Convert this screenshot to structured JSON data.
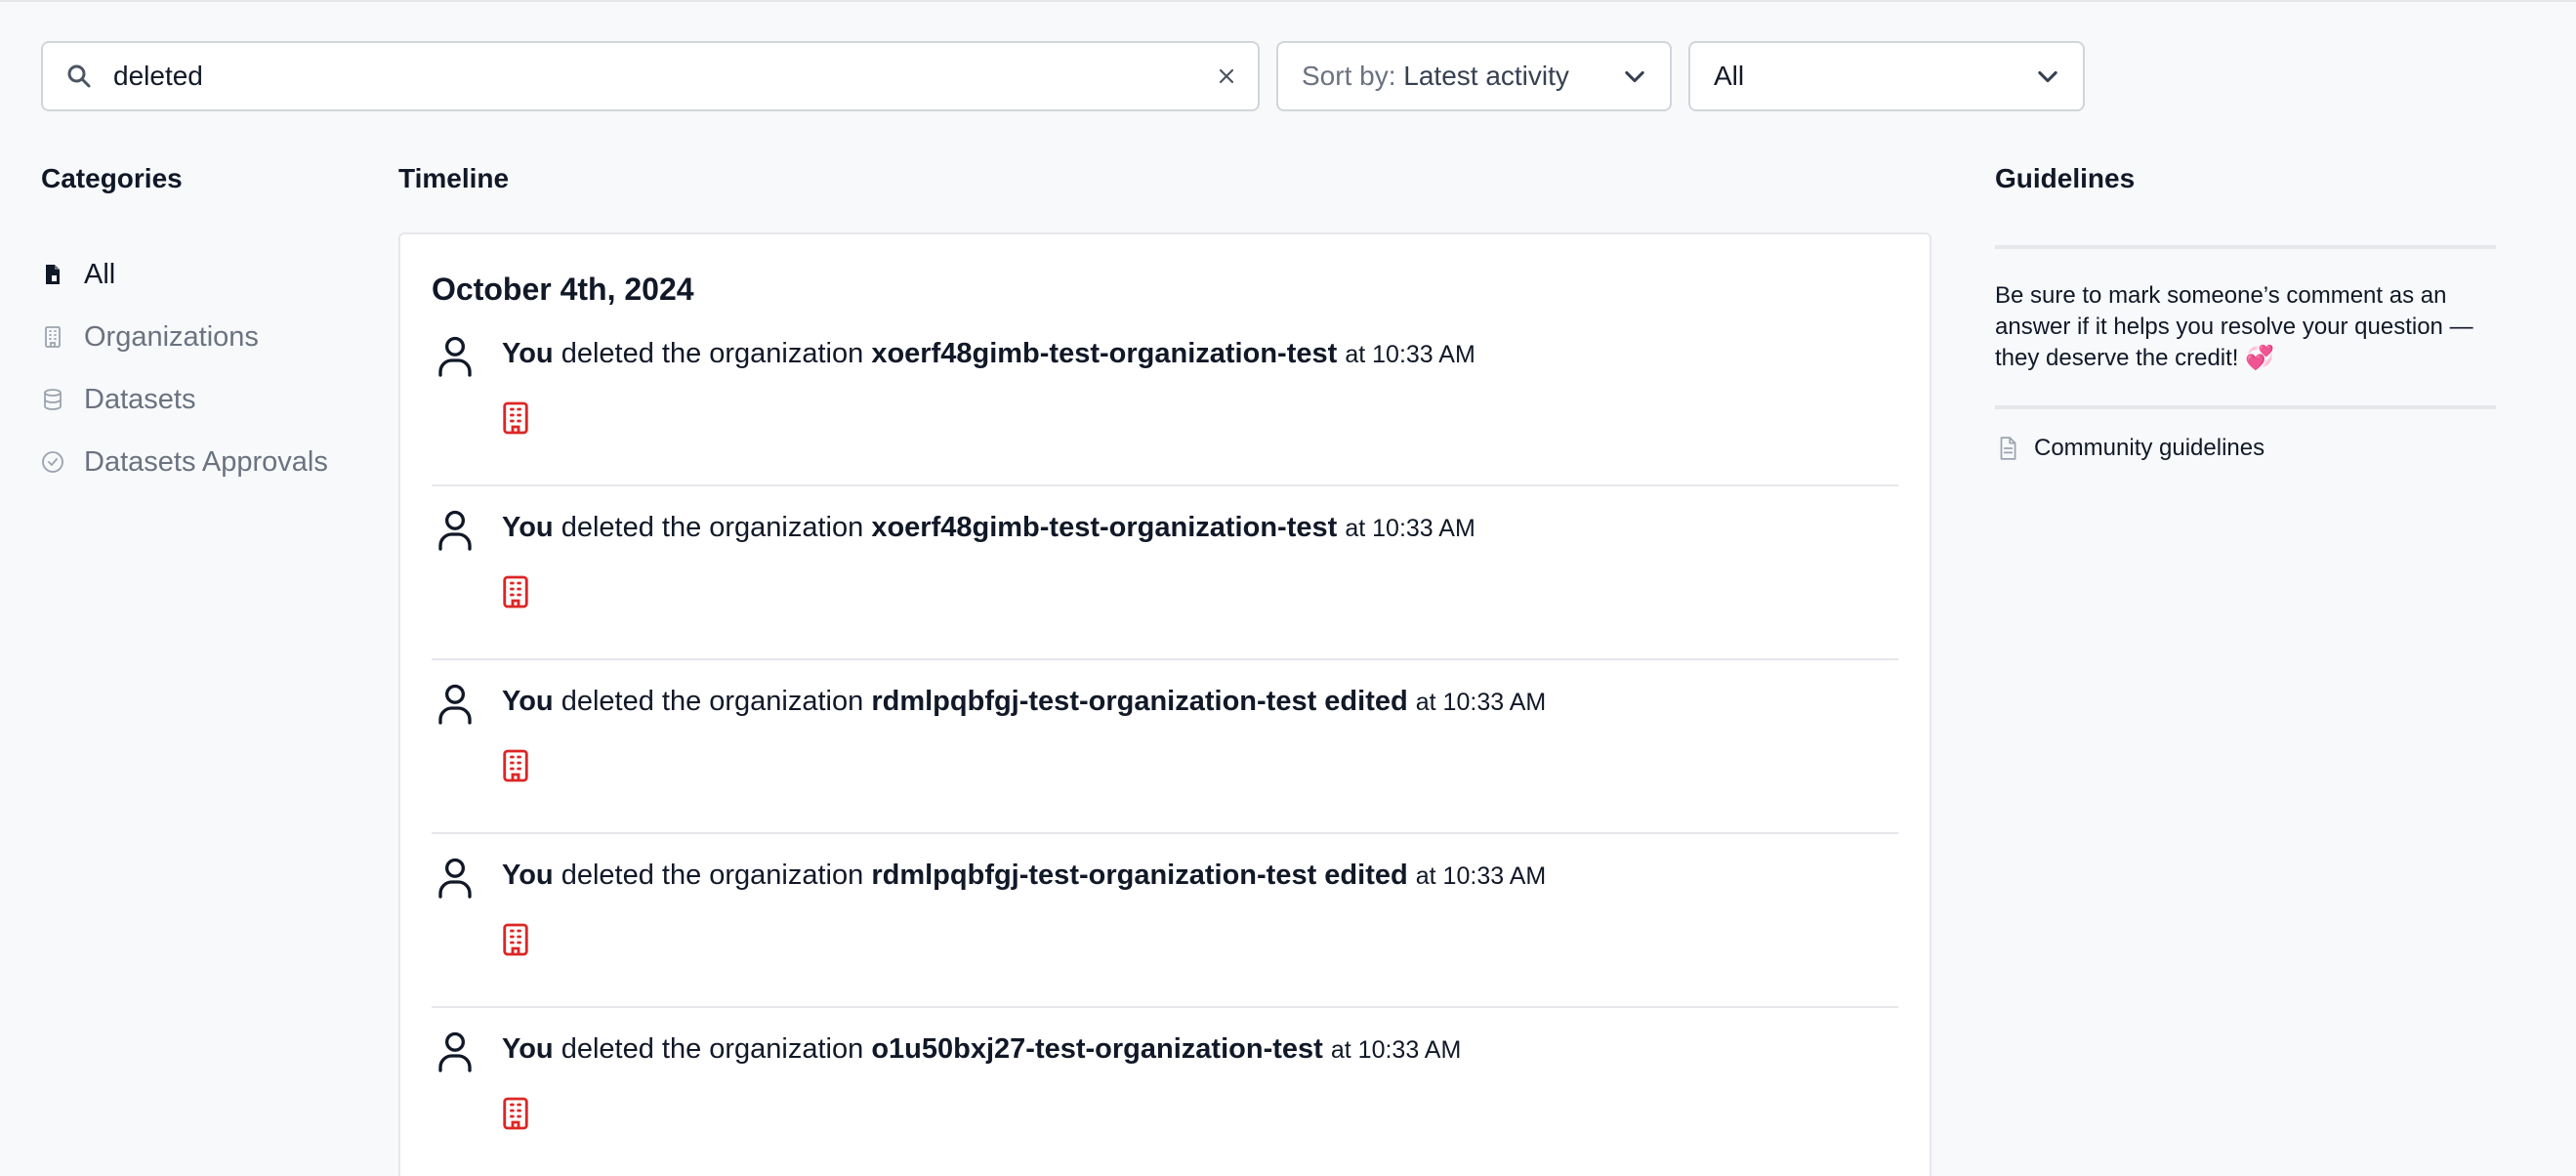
{
  "search": {
    "value": "deleted",
    "placeholder": "Search"
  },
  "sort": {
    "prefix": "Sort by:",
    "value": "Latest activity"
  },
  "filter": {
    "value": "All"
  },
  "categories": {
    "heading": "Categories",
    "items": [
      {
        "label": "All",
        "icon": "document-icon"
      },
      {
        "label": "Organizations",
        "icon": "building-icon"
      },
      {
        "label": "Datasets",
        "icon": "database-icon"
      },
      {
        "label": "Datasets Approvals",
        "icon": "check-circle-icon"
      }
    ]
  },
  "timeline": {
    "heading": "Timeline",
    "date": "October 4th, 2024",
    "entries": [
      {
        "actor": "You",
        "action": "deleted the organization",
        "target": "xoerf48gimb-test-organization-test",
        "time": "at 10:33 AM"
      },
      {
        "actor": "You",
        "action": "deleted the organization",
        "target": "xoerf48gimb-test-organization-test",
        "time": "at 10:33 AM"
      },
      {
        "actor": "You",
        "action": "deleted the organization",
        "target": "rdmlpqbfgj-test-organization-test edited",
        "time": "at 10:33 AM"
      },
      {
        "actor": "You",
        "action": "deleted the organization",
        "target": "rdmlpqbfgj-test-organization-test edited",
        "time": "at 10:33 AM"
      },
      {
        "actor": "You",
        "action": "deleted the organization",
        "target": "o1u50bxj27-test-organization-test",
        "time": "at 10:33 AM"
      }
    ]
  },
  "guidelines": {
    "heading": "Guidelines",
    "text": "Be sure to mark someone’s comment as an answer if it helps you resolve your question — they deserve the credit! 💞",
    "link_label": "Community guidelines"
  },
  "colors": {
    "accent_red": "#dc2626",
    "border": "#d1d5db",
    "muted_text": "#6b7280"
  }
}
